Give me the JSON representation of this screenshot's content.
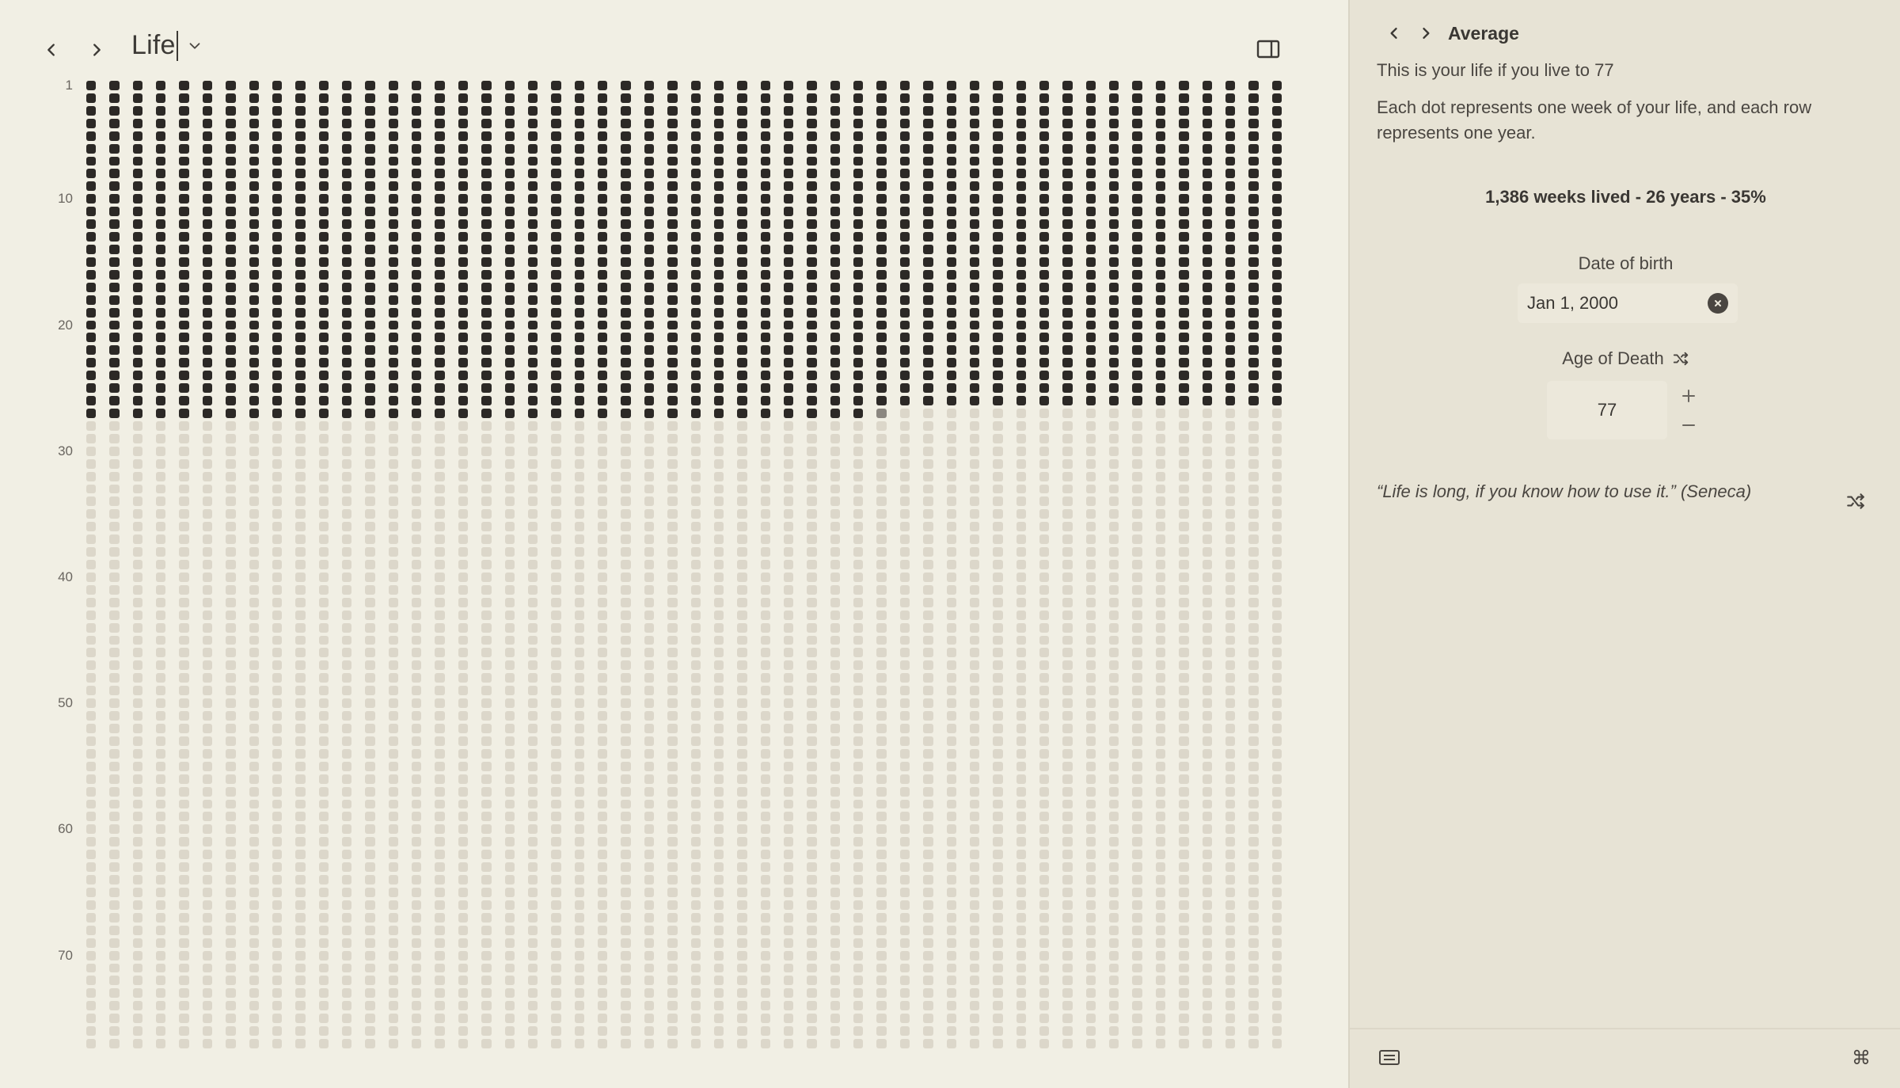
{
  "window": {
    "title": "Life",
    "back_icon": "chevron-left-icon",
    "forward_icon": "chevron-right-icon",
    "title_menu_icon": "chevron-down-icon",
    "sidebar_toggle_icon": "sidebar-toggle-icon"
  },
  "grid": {
    "row_labels": [
      {
        "text": "1",
        "row": 1
      },
      {
        "text": "10",
        "row": 10
      },
      {
        "text": "20",
        "row": 20
      },
      {
        "text": "30",
        "row": 30
      },
      {
        "text": "40",
        "row": 40
      },
      {
        "text": "50",
        "row": 50
      },
      {
        "text": "60",
        "row": 60
      },
      {
        "text": "70",
        "row": 70
      }
    ],
    "weeks_per_year": 52,
    "years": 77,
    "weeks_lived": 1386,
    "colors": {
      "lived": "#2c2926",
      "current": "#8b8780",
      "future": "#dcd7ca"
    }
  },
  "panel": {
    "title": "Average",
    "intro": "This is your life if you live to 77",
    "description": "Each dot represents one week of your life, and each row represents one year.",
    "stats": "1,386 weeks lived - 26 years - 35%",
    "dob_label": "Date of birth",
    "dob_value": "Jan 1, 2000",
    "aod_label": "Age of Death",
    "aod_value": "77",
    "quote": "“Life is long, if you know how to use it.” (Seneca)",
    "icons": {
      "dob_clear": "clear-icon",
      "aod_shuffle": "shuffle-icon",
      "increment": "plus-icon",
      "decrement": "minus-icon",
      "quote_shuffle": "shuffle-icon",
      "keyboard": "keyboard-icon",
      "command": "command-icon"
    },
    "cmd_glyph": "⌘"
  }
}
